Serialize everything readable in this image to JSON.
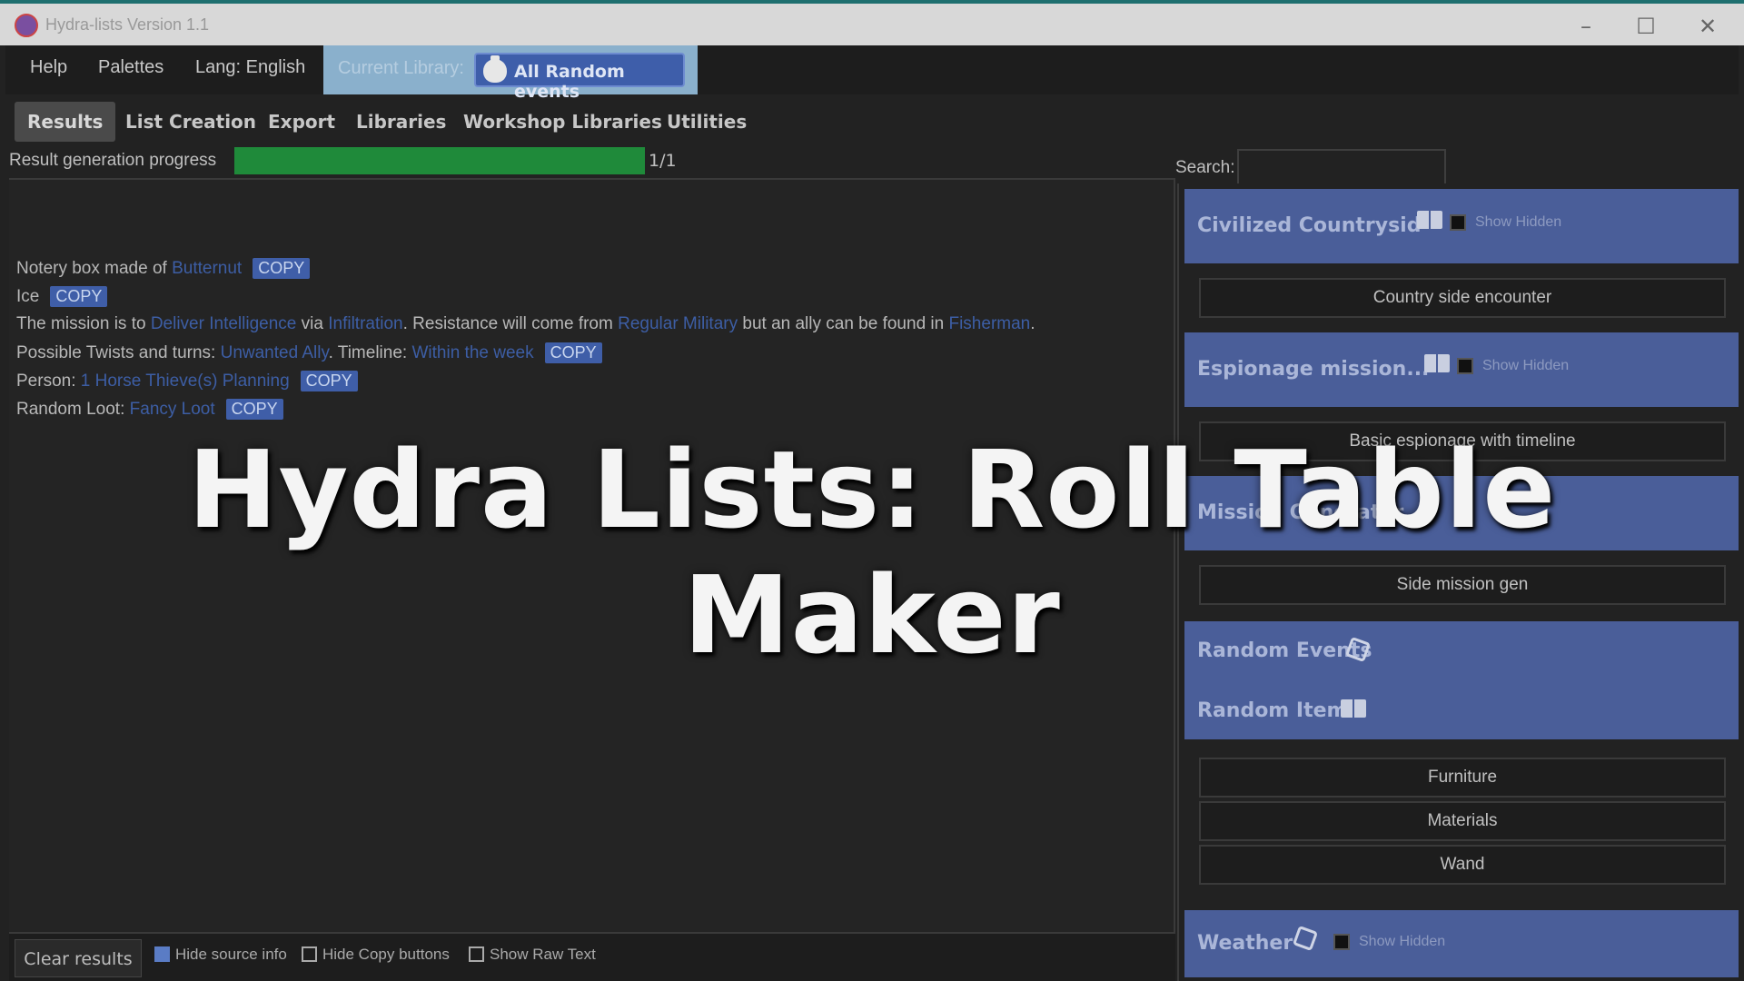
{
  "window": {
    "title": "Hydra-lists Version 1.1"
  },
  "menu": {
    "help": "Help",
    "palettes": "Palettes",
    "lang": "Lang: English",
    "current_library_label": "Current Library:",
    "current_library_value": "All Random events"
  },
  "tabs": [
    "Results",
    "List Creation",
    "Export",
    "Libraries",
    "Workshop Libraries",
    "Utilities"
  ],
  "progress": {
    "label": "Result generation progress",
    "count": "1/1",
    "fraction": 1.0
  },
  "results": {
    "copy_label": "COPY",
    "line1": {
      "text": "Notery box made of ",
      "link": "Butternut"
    },
    "line2": {
      "text": "Ice"
    },
    "line3": {
      "t1": "The mission is to ",
      "l1": "Deliver Intelligence",
      "t2": " via ",
      "l2": "Infiltration",
      "t3": ". Resistance will come from ",
      "l3": "Regular Military",
      "t4": " but an ally can be found in ",
      "l4": "Fisherman",
      "t5": "."
    },
    "line4": {
      "t1": "Possible Twists and turns: ",
      "l1": "Unwanted Ally",
      "t2": ". Timeline: ",
      "l2": "Within the week"
    },
    "line5": {
      "t1": "Person: ",
      "l1": "1 Horse Thieve(s) Planning"
    },
    "line6": {
      "t1": "Random Loot: ",
      "l1": "Fancy Loot"
    }
  },
  "bottom": {
    "clear": "Clear results",
    "hide_source": "Hide source info",
    "hide_copy": "Hide Copy buttons",
    "show_raw": "Show Raw Text"
  },
  "search": {
    "label": "Search:",
    "value": ""
  },
  "sidebar": {
    "show_hidden": "Show Hidden",
    "cat1": {
      "title": "Civilized Countrysid",
      "tables": [
        "Country side encounter"
      ]
    },
    "cat2": {
      "title": "Espionage mission...",
      "tables": [
        "Basic espionage with timeline"
      ]
    },
    "cat3": {
      "title": "Mission Generator",
      "tables": [
        "Side mission gen"
      ]
    },
    "cat4": {
      "title": "Random Events"
    },
    "cat5": {
      "title": "Random Items",
      "tables": [
        "Furniture",
        "Materials",
        "Wand"
      ]
    },
    "cat6": {
      "title": "Weather"
    }
  },
  "overlay": {
    "title": "Hydra Lists: Roll Table Maker"
  },
  "colors": {
    "accent": "#4a5e99",
    "progress": "#1f8a3a",
    "link": "#3d5ea5"
  }
}
